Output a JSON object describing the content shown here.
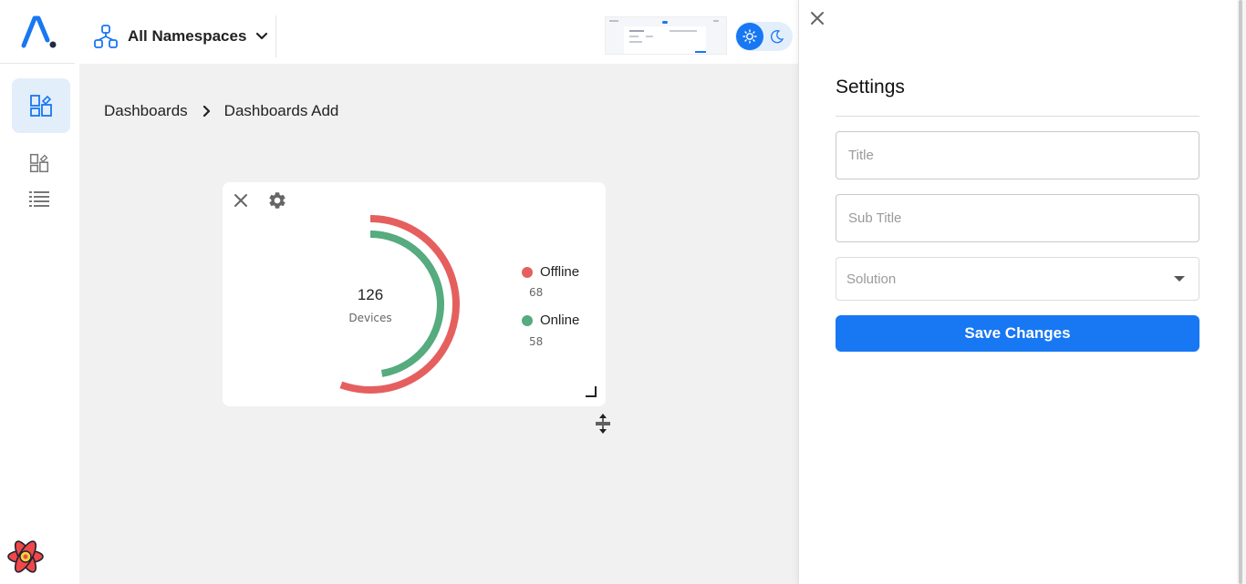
{
  "header": {
    "namespace_label": "All Namespaces"
  },
  "breadcrumb": {
    "items": [
      "Dashboards",
      "Dashboards Add"
    ]
  },
  "widget": {
    "total_value": "126",
    "total_label": "Devices",
    "legend": [
      {
        "label": "Offline",
        "value": "68",
        "color": "#e65f5f"
      },
      {
        "label": "Online",
        "value": "58",
        "color": "#56ab7f"
      }
    ]
  },
  "chart_data": {
    "type": "pie",
    "categories": [
      "Offline",
      "Online"
    ],
    "values": [
      68,
      58
    ],
    "colors": [
      "#e65f5f",
      "#56ab7f"
    ],
    "title": "126",
    "subtitle": "Devices",
    "legend_position": "right"
  },
  "settings": {
    "title": "Settings",
    "title_placeholder": "Title",
    "subtitle_placeholder": "Sub Title",
    "solution_placeholder": "Solution",
    "save_label": "Save Changes"
  },
  "colors": {
    "accent": "#1877f2",
    "accent_light": "#e3eefb",
    "offline": "#e65f5f",
    "online": "#56ab7f"
  },
  "icons": {
    "logo": "app-logo-icon",
    "namespace": "namespace-network-icon",
    "dashboards": "dashboard-icon",
    "list": "list-icon",
    "light_mode": "sun-icon",
    "dark_mode": "moon-icon",
    "close": "close-icon",
    "settings": "gear-icon",
    "react": "react-icon"
  }
}
